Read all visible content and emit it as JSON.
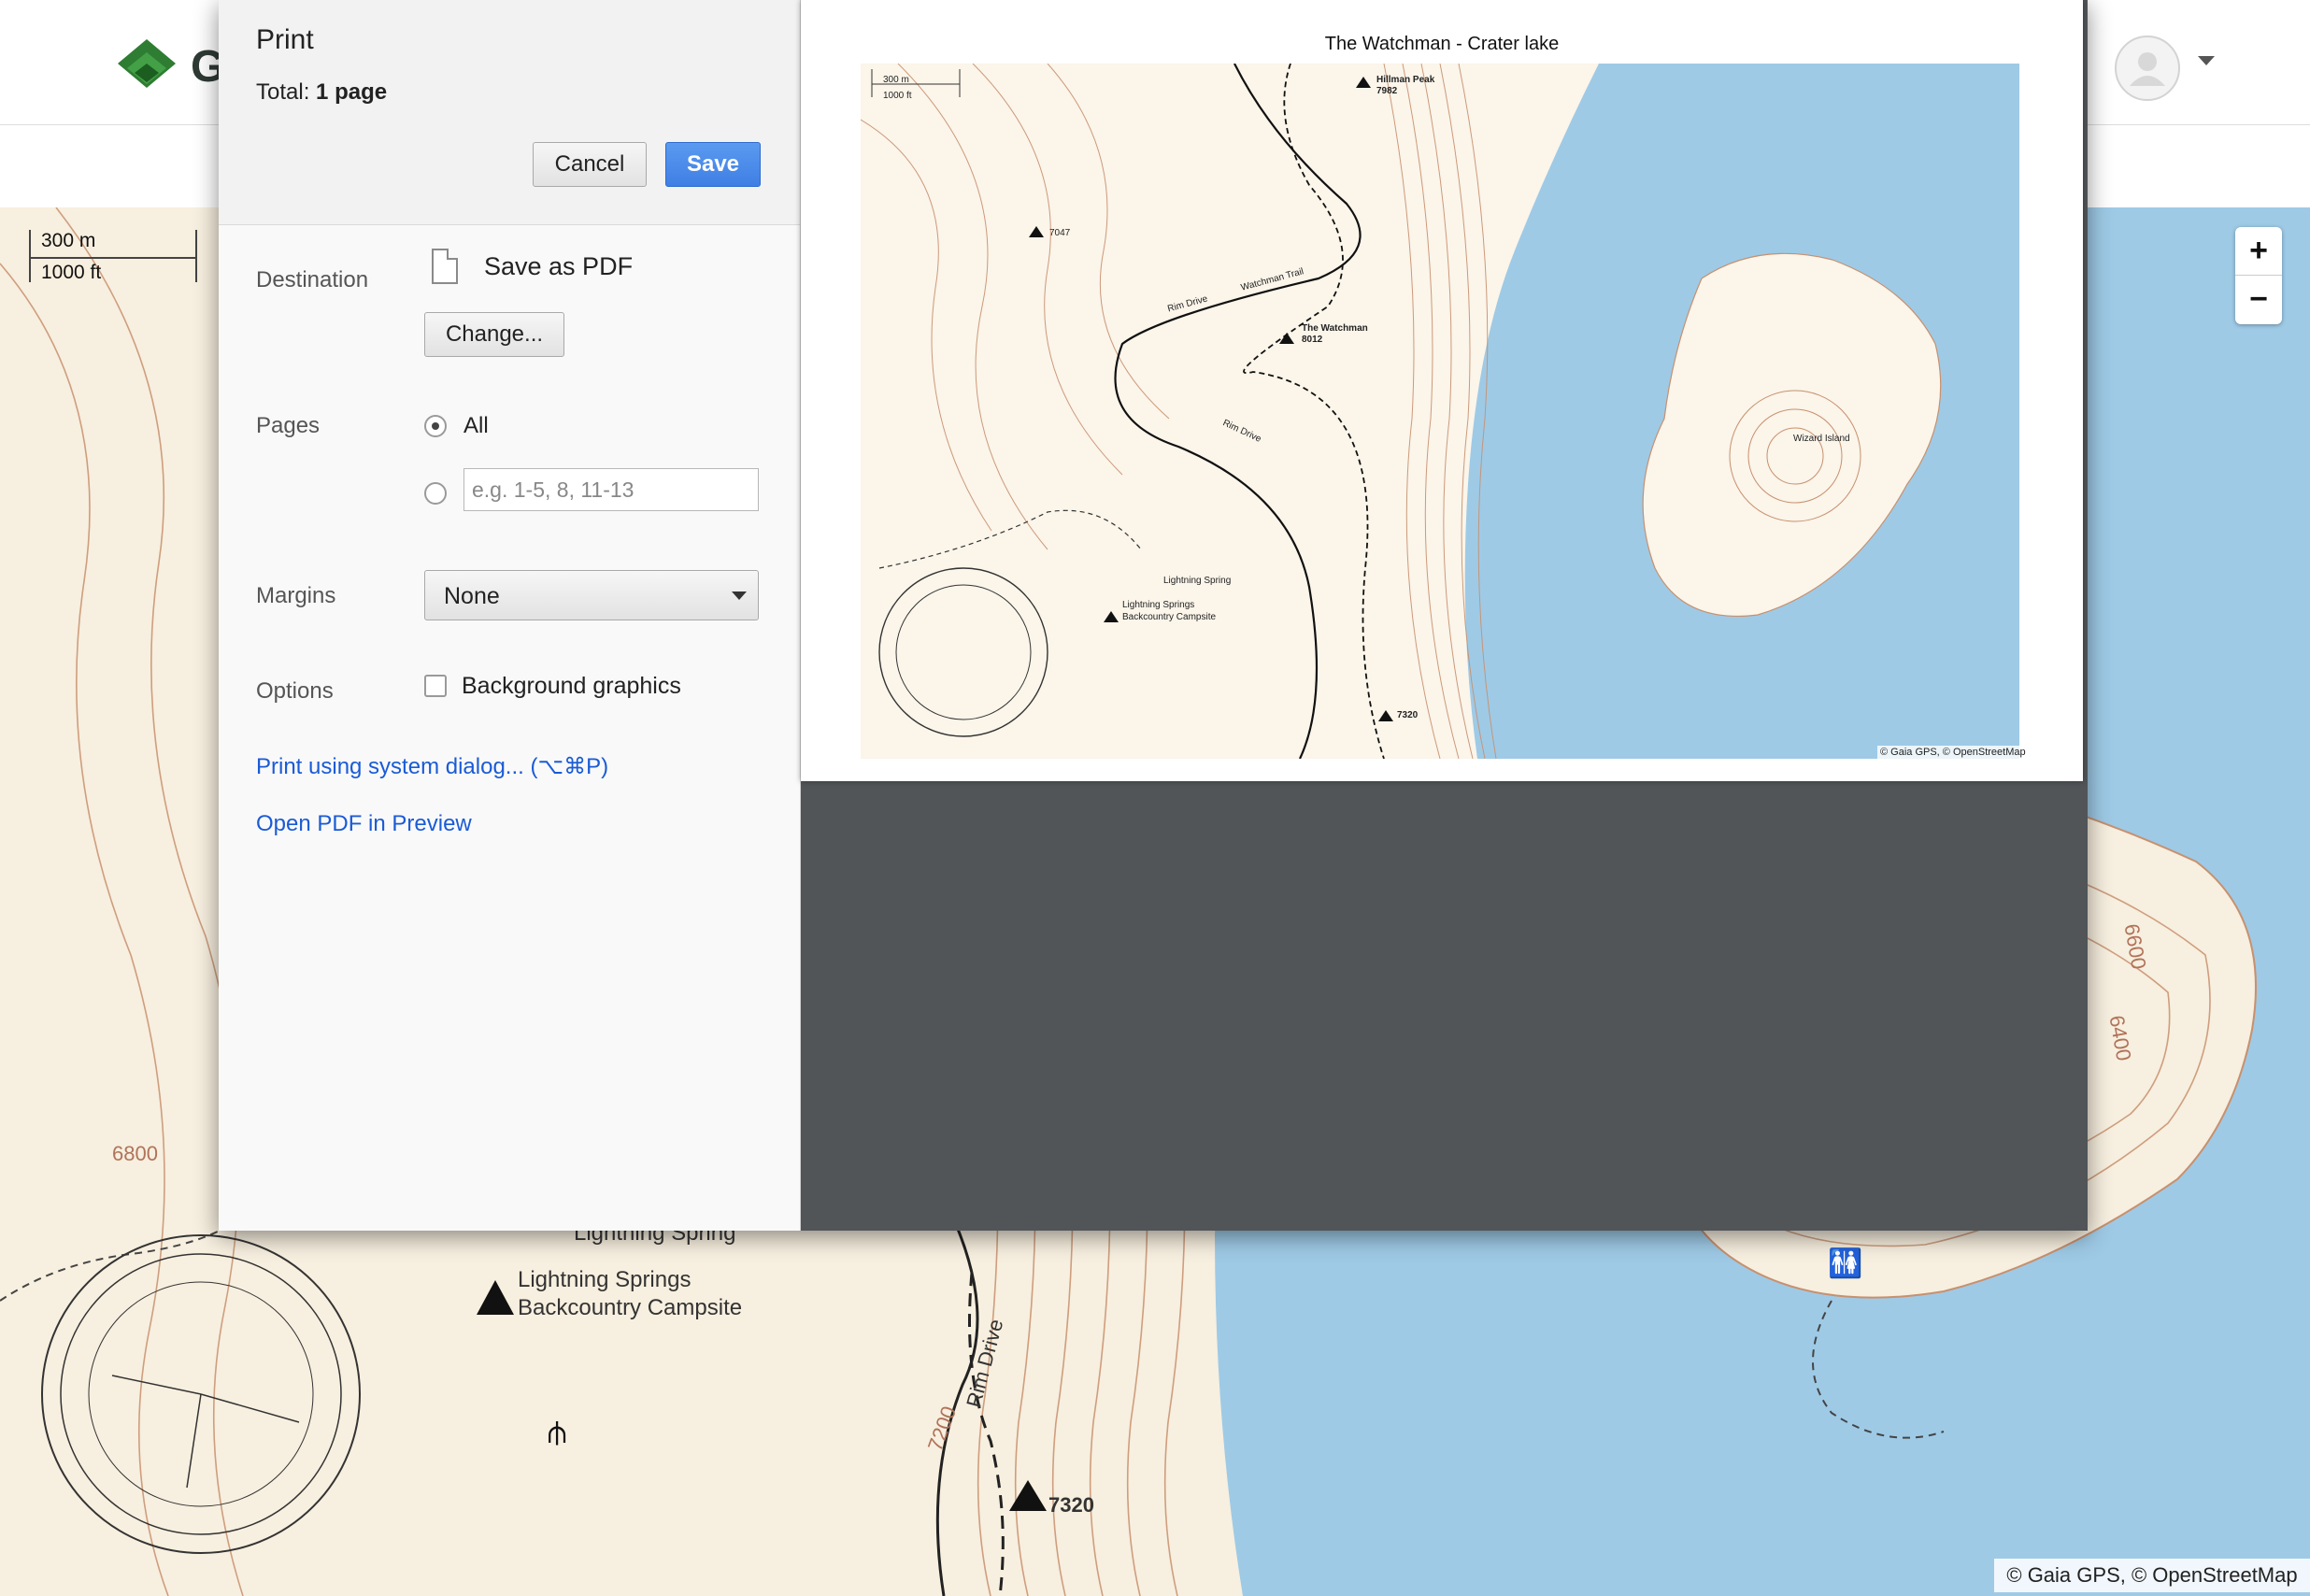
{
  "app": {
    "logo_letter": "G"
  },
  "map": {
    "scale_metric": "300 m",
    "scale_imperial": "1000 ft",
    "zoom_in": "+",
    "zoom_out": "−",
    "attribution": "© Gaia GPS, © OpenStreetMap",
    "labels": {
      "contour_6800": "6800",
      "contour_6600": "6600",
      "contour_6400": "6400",
      "contour_7200": "7200",
      "lightning_spring": "Lightning Spring",
      "campsite_line1": "Lightning Springs",
      "campsite_line2": "Backcountry Campsite",
      "rim_drive": "Rim Drive",
      "summit_7320": "7320"
    },
    "colors": {
      "terrain": "#f7efdf",
      "contour": "#c8906e",
      "water": "#9ecae6",
      "trail": "#222222"
    }
  },
  "print_dialog": {
    "title": "Print",
    "total_label": "Total:",
    "total_value": "1 page",
    "cancel_label": "Cancel",
    "save_label": "Save",
    "destination_label": "Destination",
    "destination_value": "Save as PDF",
    "change_label": "Change...",
    "pages_label": "Pages",
    "pages_all_label": "All",
    "pages_placeholder": "e.g. 1-5, 8, 11-13",
    "margins_label": "Margins",
    "margins_value": "None",
    "options_label": "Options",
    "background_graphics_label": "Background graphics",
    "system_dialog_link": "Print using system dialog... (⌥⌘P)",
    "open_pdf_link": "Open PDF in Preview"
  },
  "preview": {
    "title": "The Watchman - Crater lake",
    "scale_metric": "300 m",
    "scale_imperial": "1000 ft",
    "attribution": "© Gaia GPS, © OpenStreetMap",
    "labels": {
      "hillman_peak": "Hillman Peak",
      "hillman_elev": "7982",
      "peak_7047": "7047",
      "watchman": "The Watchman",
      "watchman_elev": "8012",
      "watchman_trail": "Watchman Trail",
      "rim_drive": "Rim Drive",
      "rim_drive_2": "Rim Drive",
      "wizard_island": "Wizard Island",
      "lightning_spring": "Lightning Spring",
      "campsite_line1": "Lightning Springs",
      "campsite_line2": "Backcountry Campsite",
      "peak_7320": "7320"
    }
  }
}
